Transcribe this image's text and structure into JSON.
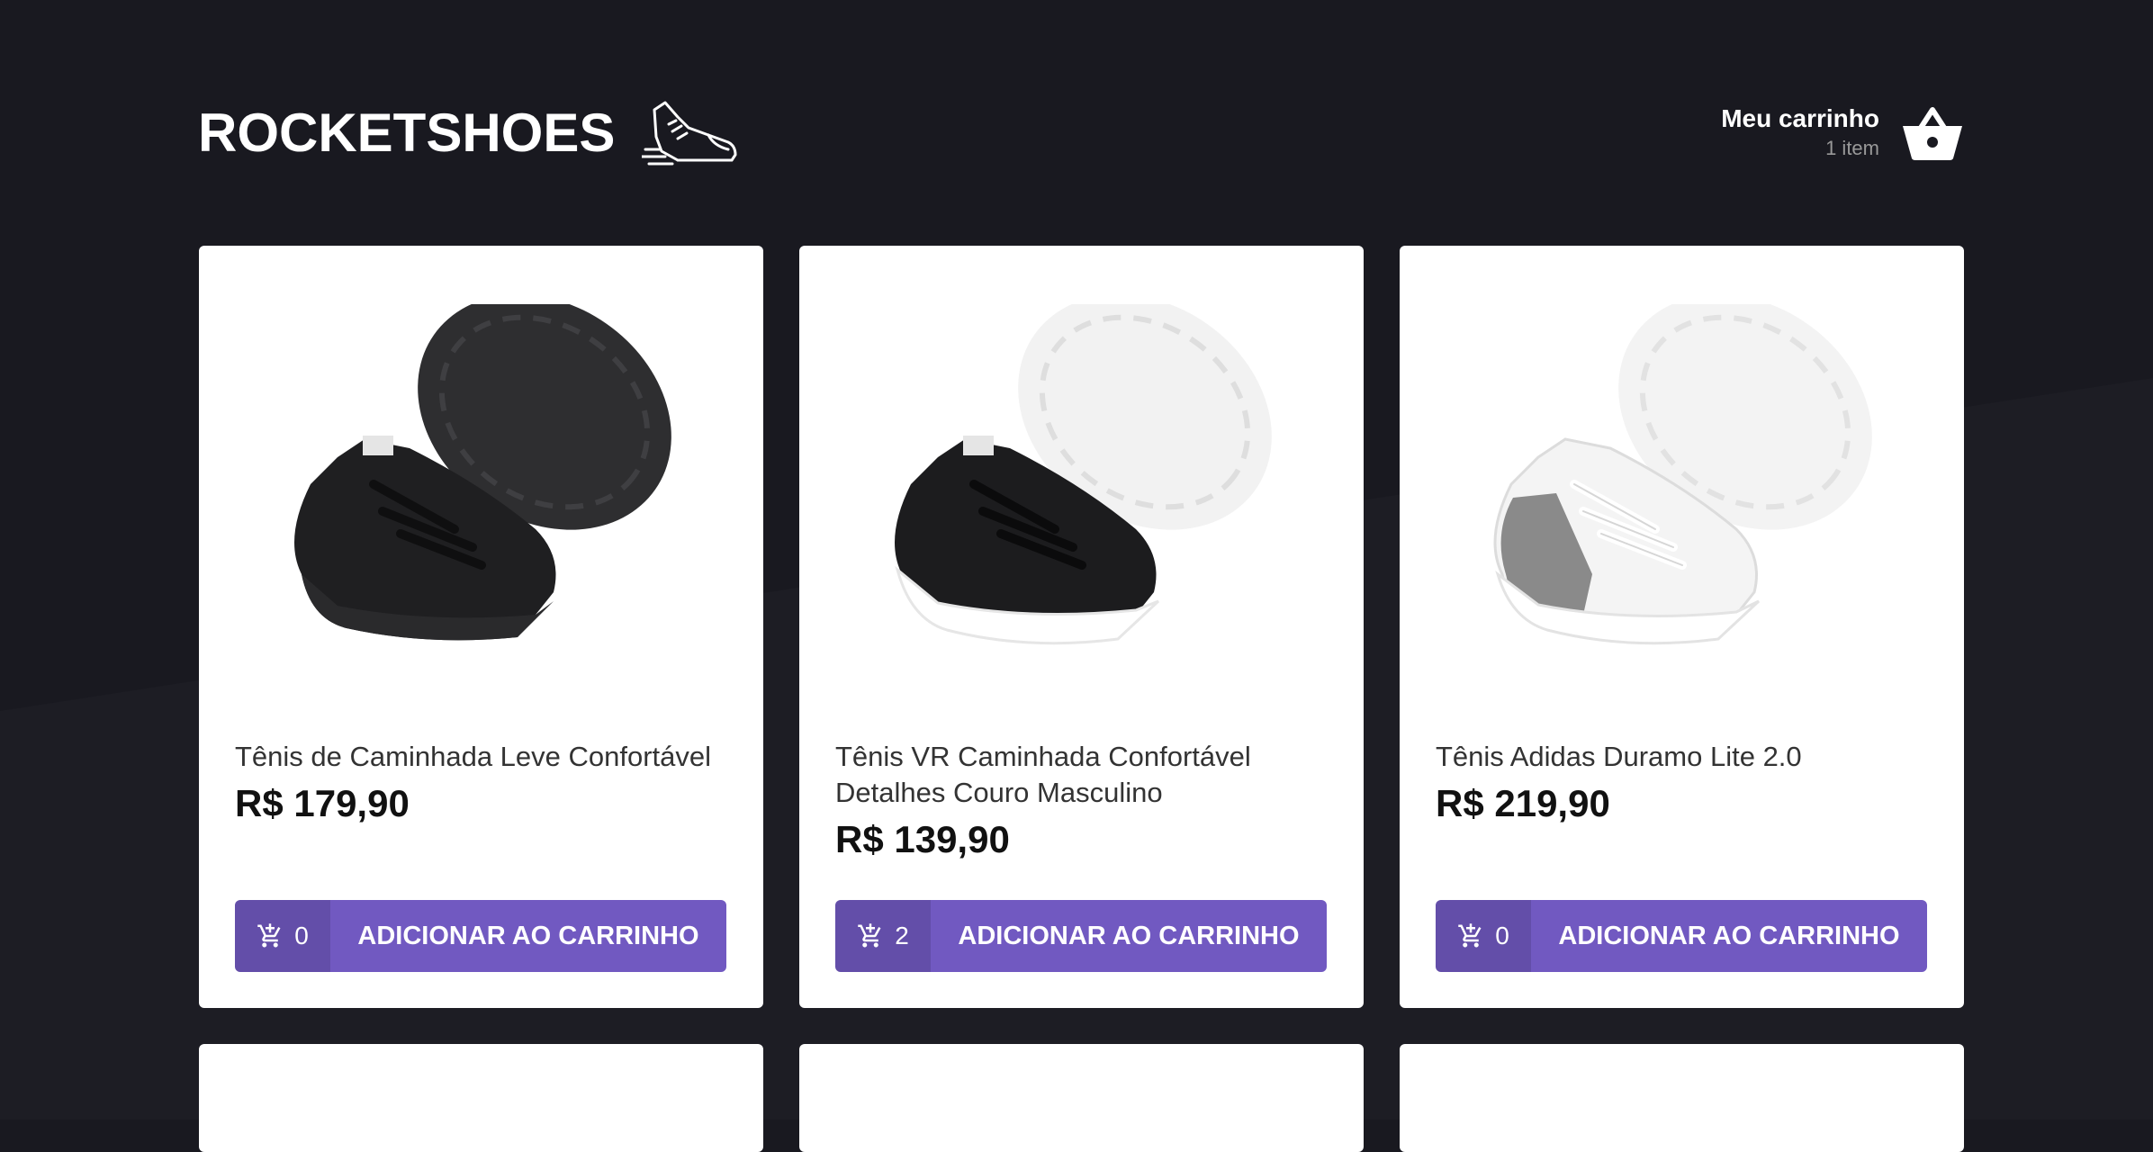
{
  "header": {
    "logo_text": "ROCKETSHOES",
    "logo_icon": "running-shoe-icon",
    "cart_title": "Meu carrinho",
    "cart_count": "1 item",
    "cart_icon": "shopping-basket-icon"
  },
  "colors": {
    "background": "#191920",
    "accent": "#7159c1",
    "card": "#ffffff"
  },
  "products": [
    {
      "title": "Tênis de Caminhada Leve Confortável",
      "price": "R$ 179,90",
      "cart_amount": "0",
      "button_label": "ADICIONAR AO CARRINHO",
      "image": "black-sneaker"
    },
    {
      "title": "Tênis VR Caminhada Confortável Detalhes Couro Masculino",
      "price": "R$ 139,90",
      "cart_amount": "2",
      "button_label": "ADICIONAR AO CARRINHO",
      "image": "black-white-sneaker"
    },
    {
      "title": "Tênis Adidas Duramo Lite 2.0",
      "price": "R$ 219,90",
      "cart_amount": "0",
      "button_label": "ADICIONAR AO CARRINHO",
      "image": "white-grey-sneaker"
    }
  ]
}
